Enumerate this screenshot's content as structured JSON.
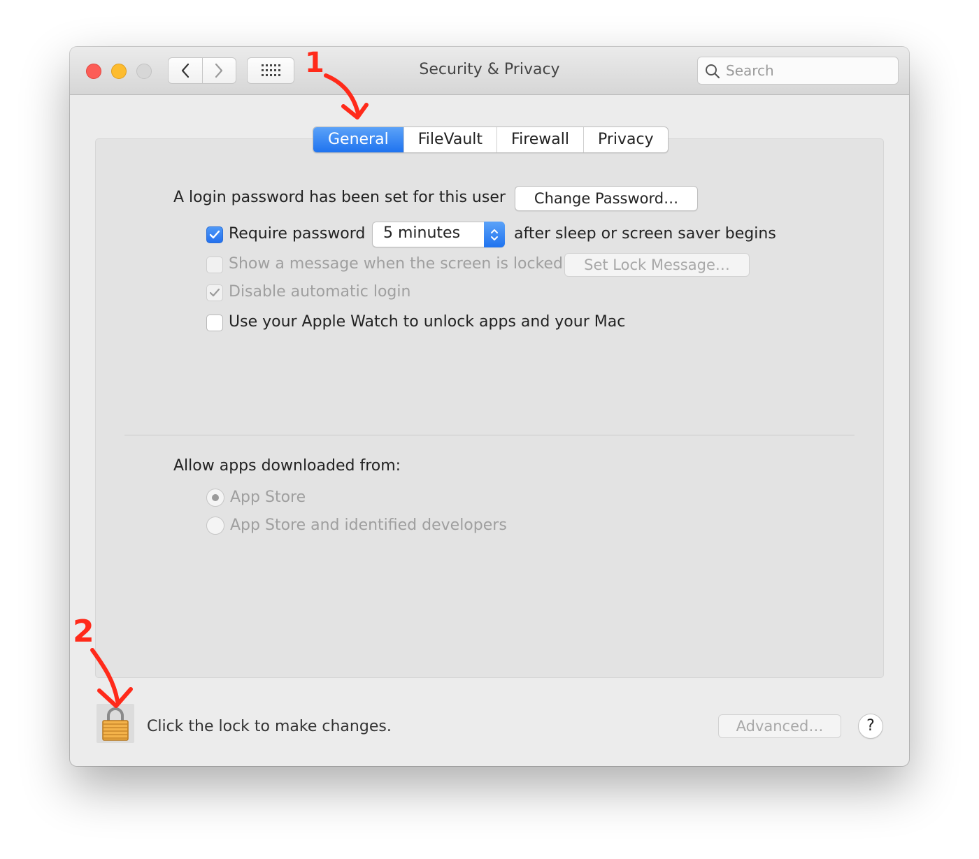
{
  "window": {
    "title": "Security & Privacy"
  },
  "search": {
    "placeholder": "Search"
  },
  "tabs": [
    {
      "label": "General",
      "active": true
    },
    {
      "label": "FileVault",
      "active": false
    },
    {
      "label": "Firewall",
      "active": false
    },
    {
      "label": "Privacy",
      "active": false
    }
  ],
  "general": {
    "login_password_text": "A login password has been set for this user",
    "change_password_label": "Change Password…",
    "require_password": {
      "label": "Require password",
      "checked": true
    },
    "require_delay_value": "5 minutes",
    "after_sleep_text": "after sleep or screen saver begins",
    "show_message": {
      "label": "Show a message when the screen is locked",
      "checked": false,
      "enabled": false
    },
    "set_lock_message_label": "Set Lock Message…",
    "disable_auto_login": {
      "label": "Disable automatic login",
      "checked": true,
      "enabled": false
    },
    "apple_watch": {
      "label": "Use your Apple Watch to unlock apps and your Mac",
      "checked": false
    },
    "allow_apps_heading": "Allow apps downloaded from:",
    "allow_options": [
      {
        "label": "App Store",
        "selected": true
      },
      {
        "label": "App Store and identified developers",
        "selected": false
      }
    ]
  },
  "footer": {
    "lock_text": "Click the lock to make changes.",
    "advanced_label": "Advanced…",
    "help_label": "?"
  },
  "annotations": {
    "marker_1": "1",
    "marker_2": "2"
  },
  "colors": {
    "accent": "#1f73ef",
    "annotation": "#ff2a1a"
  }
}
